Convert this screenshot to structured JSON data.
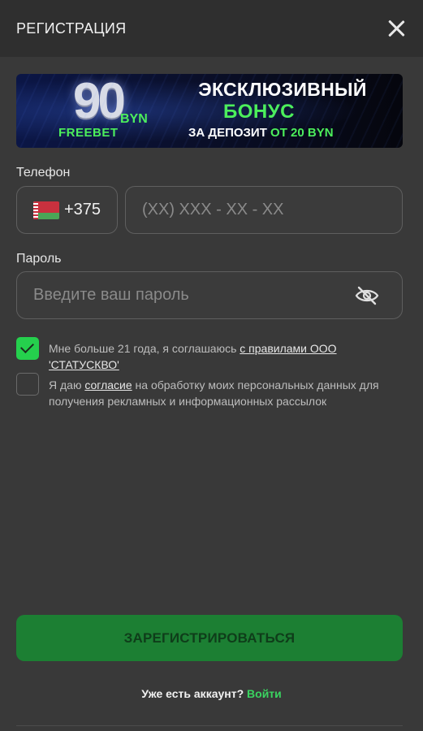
{
  "header": {
    "title": "РЕГИСТРАЦИЯ"
  },
  "banner": {
    "amount": "90",
    "currency": "BYN",
    "freebet": "FREEBET",
    "line1": "ЭКСКЛЮЗИВНЫЙ",
    "line2": "БОНУС",
    "line3_prefix": "ЗА ДЕПОЗИТ ",
    "line3_highlight": "ОТ 20 BYN"
  },
  "phone": {
    "label": "Телефон",
    "country_code": "+375",
    "country_flag": "belarus-flag",
    "placeholder": "(XX) XXX - XX - XX",
    "value": ""
  },
  "password": {
    "label": "Пароль",
    "placeholder": "Введите ваш пароль",
    "value": ""
  },
  "consents": {
    "age": {
      "checked": true,
      "text": "Мне больше 21 года, я соглашаюсь ",
      "link": "с правилами ООО 'СТАТУСКВО'"
    },
    "marketing": {
      "checked": false,
      "text_before": "Я даю ",
      "link": "согласие",
      "text_after": " на обработку моих персональных данных для получения рекламных и информационных рассылок"
    }
  },
  "submit_label": "ЗАРЕГИСТРИРОВАТЬСЯ",
  "login": {
    "prompt": "Уже есть аккаунт? ",
    "link": "Войти"
  },
  "colors": {
    "accent_green": "#25d04d",
    "button_green": "#1c7f33",
    "background": "#393939",
    "header": "#2f2f2f"
  }
}
